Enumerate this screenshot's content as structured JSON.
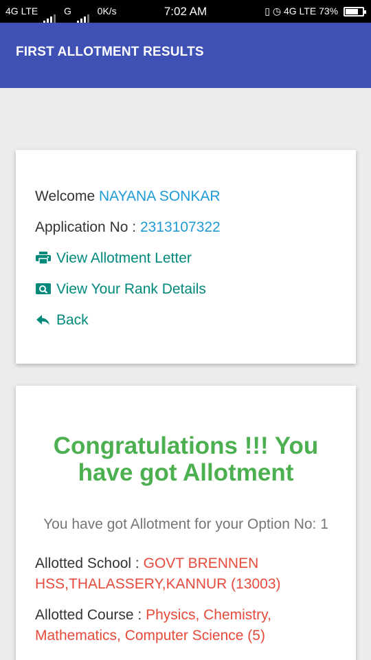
{
  "status_bar": {
    "network1": "4G LTE",
    "network2": "G",
    "speed": "0K/s",
    "time": "7:02 AM",
    "network3": "4G LTE",
    "battery_percent": "73%",
    "battery_level": 0.73
  },
  "app_bar": {
    "title": "FIRST ALLOTMENT RESULTS"
  },
  "info_card": {
    "welcome_label": "Welcome",
    "name": "NAYANA SONKAR",
    "application_label": "Application No :",
    "application_no": "2313107322",
    "links": [
      {
        "label": "View Allotment Letter",
        "icon": "print-icon"
      },
      {
        "label": "View Your Rank Details",
        "icon": "search-icon"
      },
      {
        "label": "Back",
        "icon": "reply-icon"
      }
    ]
  },
  "result_card": {
    "congrats_line1": "Congratulations !!! You",
    "congrats_line2": "have got Allotment",
    "option_text": "You have got Allotment for your Option No: 1",
    "school_label": "Allotted School :",
    "school_value": "GOVT BRENNEN HSS,THALASSERY,KANNUR (13003)",
    "course_label": "Allotted Course :",
    "course_value": "Physics, Chemistry, Mathematics, Computer Science (5)"
  },
  "colors": {
    "app_bar": "#3f51b5",
    "accent_blue": "#1e9ad6",
    "link_teal": "#00897b",
    "success_green": "#4caf50",
    "value_red": "#e64a3b"
  }
}
